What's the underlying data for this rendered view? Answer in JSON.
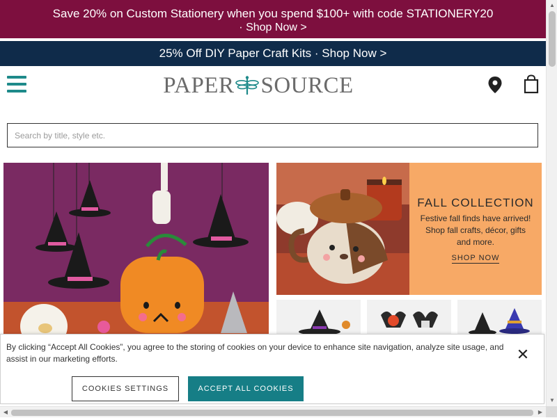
{
  "promo_top": {
    "line1": "Save 20% on Custom Stationery when you spend $100+ with code STATIONERY20",
    "line2": "· Shop Now >",
    "background": "#7d0f3e"
  },
  "promo_second": {
    "text": "25% Off DIY Paper Craft Kits · Shop Now >",
    "background": "#0f2b4a"
  },
  "header": {
    "logo_left": "PAPER",
    "logo_right": "SOURCE",
    "menu_icon": "hamburger-menu-icon",
    "store_icon": "map-pin-icon",
    "cart_icon": "shopping-bag-icon",
    "accent": "#1e8a8a"
  },
  "search": {
    "placeholder": "Search by title, style etc.",
    "value": ""
  },
  "fall_collection": {
    "title": "FALL COLLECTION",
    "description": "Festive fall finds have arrived! Shop fall crafts, décor, gifts and more.",
    "link": "SHOP NOW",
    "background": "#f7a966"
  },
  "cookie_banner": {
    "message": "By clicking “Accept All Cookies”, you agree to the storing of cookies on your device to enhance site navigation, analyze site usage, and assist in our marketing efforts.",
    "settings_label": "COOKIES SETTINGS",
    "accept_label": "ACCEPT ALL COOKIES",
    "close_label": "✕",
    "accept_color": "#167e86"
  }
}
